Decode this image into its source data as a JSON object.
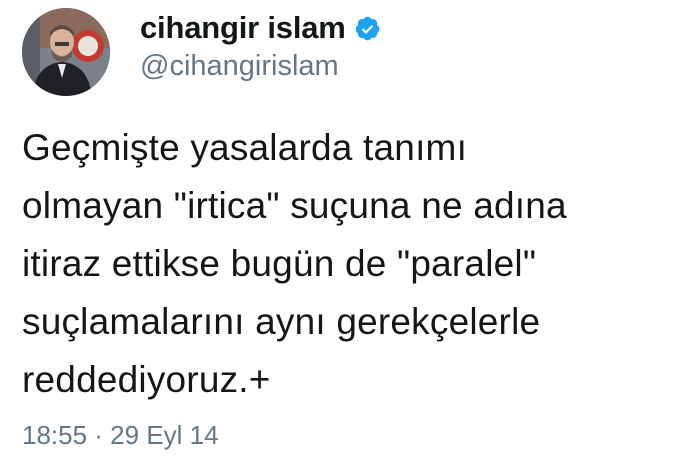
{
  "author": {
    "display_name": "cihangir islam",
    "handle": "@cihangirislam",
    "verified": true,
    "avatar_icon": "profile-photo",
    "verified_icon": "verified-badge-icon"
  },
  "tweet": {
    "lines": [
      "Geçmişte yasalarda tanımı",
      "olmayan \"irtica\" suçuna ne adına",
      "itiraz ettikse bugün de \"paralel\"",
      "suçlamalarını aynı gerekçelerle",
      "reddediyoruz.+"
    ]
  },
  "meta": {
    "timestamp": "18:55 · 29 Eyl 14"
  },
  "colors": {
    "text_primary": "#14171a",
    "text_secondary": "#657786",
    "verified_blue": "#1da1f2",
    "background": "#ffffff"
  }
}
